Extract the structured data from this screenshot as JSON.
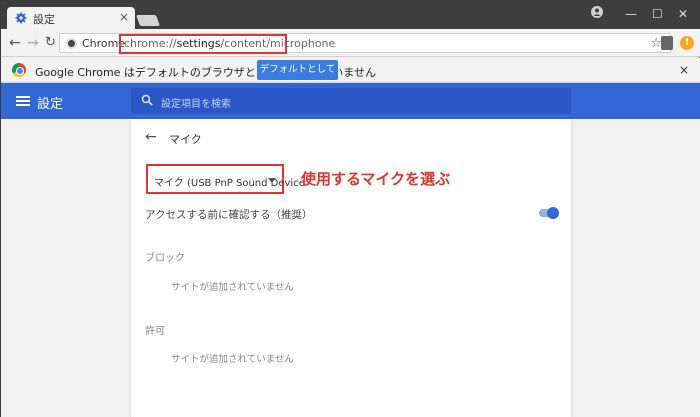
{
  "window": {
    "tab_title": "設定",
    "tab_close": "×",
    "profile_icon": "profile-icon",
    "minimize": "—",
    "maximize": "☐",
    "close": "✕"
  },
  "toolbar": {
    "site_name": "Chrome",
    "url_prefix": "chrome://",
    "url_bold": "settings",
    "url_rest": "/content/microphone",
    "star": "☆",
    "ext_badge": "!"
  },
  "infobar": {
    "text": "Google Chrome はデフォルトのブラウザとして設定されていません",
    "button": "デフォルトとして設定",
    "close": "×"
  },
  "header": {
    "title": "設定",
    "search_placeholder": "設定項目を検索"
  },
  "page": {
    "back": "←",
    "title": "マイク",
    "mic_select": "マイク (USB PnP Sound Device",
    "annotation": "使用するマイクを選ぶ",
    "toggle_label": "アクセスする前に確認する（推奨）",
    "toggle_on": true,
    "block_title": "ブロック",
    "block_empty": "サイトが追加されていません",
    "allow_title": "許可",
    "allow_empty": "サイトが追加されていません"
  },
  "colors": {
    "header_blue": "#3367d6",
    "highlight_red": "#e0362b"
  }
}
